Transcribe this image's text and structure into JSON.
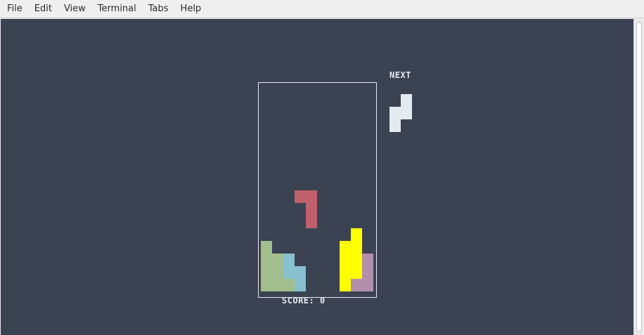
{
  "menubar": {
    "items": [
      "File",
      "Edit",
      "View",
      "Terminal",
      "Tabs",
      "Help"
    ]
  },
  "game": {
    "score_label": "SCORE:",
    "score": "0",
    "next_label": "NEXT",
    "colors": {
      "background": "#3b4252",
      "border": "#e5e9f0",
      "green": "#a3be8c",
      "cyan": "#88c0d0",
      "yellow": "#ffff00",
      "purple": "#b48ead",
      "red": "#bf616a",
      "white": "#e5e9f0"
    },
    "board": {
      "columns": 10,
      "rows": 16,
      "locked": [
        {
          "piece": "green",
          "color": "#a3be8c",
          "cells": [
            [
              0,
              12
            ],
            [
              0,
              13
            ],
            [
              1,
              13
            ],
            [
              0,
              14
            ],
            [
              1,
              14
            ],
            [
              0,
              15
            ],
            [
              1,
              15
            ],
            [
              2,
              15
            ]
          ]
        },
        {
          "piece": "cyan",
          "color": "#88c0d0",
          "cells": [
            [
              2,
              13
            ],
            [
              2,
              14
            ],
            [
              3,
              14
            ],
            [
              3,
              15
            ]
          ]
        },
        {
          "piece": "yellow",
          "color": "#ffff00",
          "cells": [
            [
              8,
              11
            ],
            [
              7,
              12
            ],
            [
              8,
              12
            ],
            [
              7,
              13
            ],
            [
              8,
              13
            ],
            [
              7,
              14
            ],
            [
              8,
              14
            ],
            [
              7,
              15
            ]
          ]
        },
        {
          "piece": "purple",
          "color": "#b48ead",
          "cells": [
            [
              9,
              13
            ],
            [
              9,
              14
            ],
            [
              8,
              15
            ],
            [
              9,
              15
            ]
          ]
        }
      ],
      "falling": {
        "piece": "red",
        "color": "#bf616a",
        "cells": [
          [
            3,
            8
          ],
          [
            4,
            8
          ],
          [
            4,
            9
          ],
          [
            4,
            10
          ]
        ]
      }
    },
    "next_piece": {
      "color": "#e5e9f0",
      "cells": [
        [
          1,
          0
        ],
        [
          0,
          1
        ],
        [
          1,
          1
        ],
        [
          0,
          2
        ]
      ]
    }
  }
}
